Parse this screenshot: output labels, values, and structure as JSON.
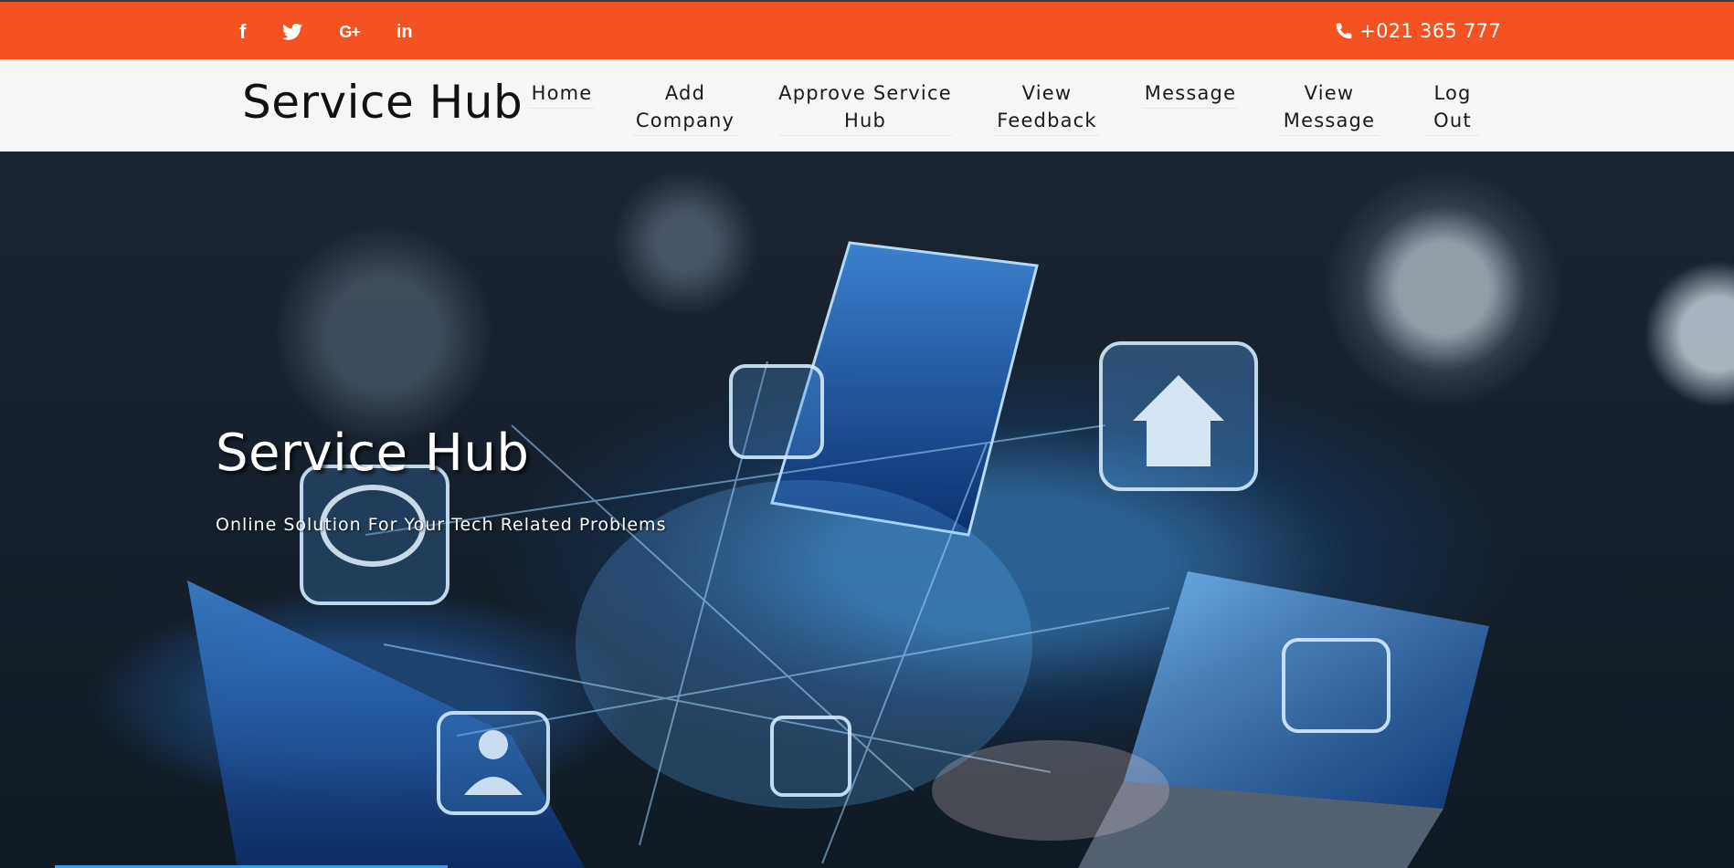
{
  "topbar": {
    "social": [
      {
        "icon": "facebook-icon",
        "glyph": "f"
      },
      {
        "icon": "twitter-icon",
        "glyph": ""
      },
      {
        "icon": "google-plus-icon",
        "glyph": "G+"
      },
      {
        "icon": "linkedin-icon",
        "glyph": "in"
      }
    ],
    "phone": "+021 365 777",
    "bg_color": "#f45220"
  },
  "navbar": {
    "brand": "Service Hub",
    "items": [
      {
        "line1": "Home",
        "line2": ""
      },
      {
        "line1": "Add",
        "line2": "Company"
      },
      {
        "line1": "Approve Service",
        "line2": "Hub"
      },
      {
        "line1": "View",
        "line2": "Feedback"
      },
      {
        "line1": "Message",
        "line2": ""
      },
      {
        "line1": "View",
        "line2": "Message"
      },
      {
        "line1": "Log",
        "line2": "Out"
      }
    ]
  },
  "hero": {
    "title": "Service Hub",
    "subtitle": "Online Solution For Your Tech Related Problems"
  }
}
